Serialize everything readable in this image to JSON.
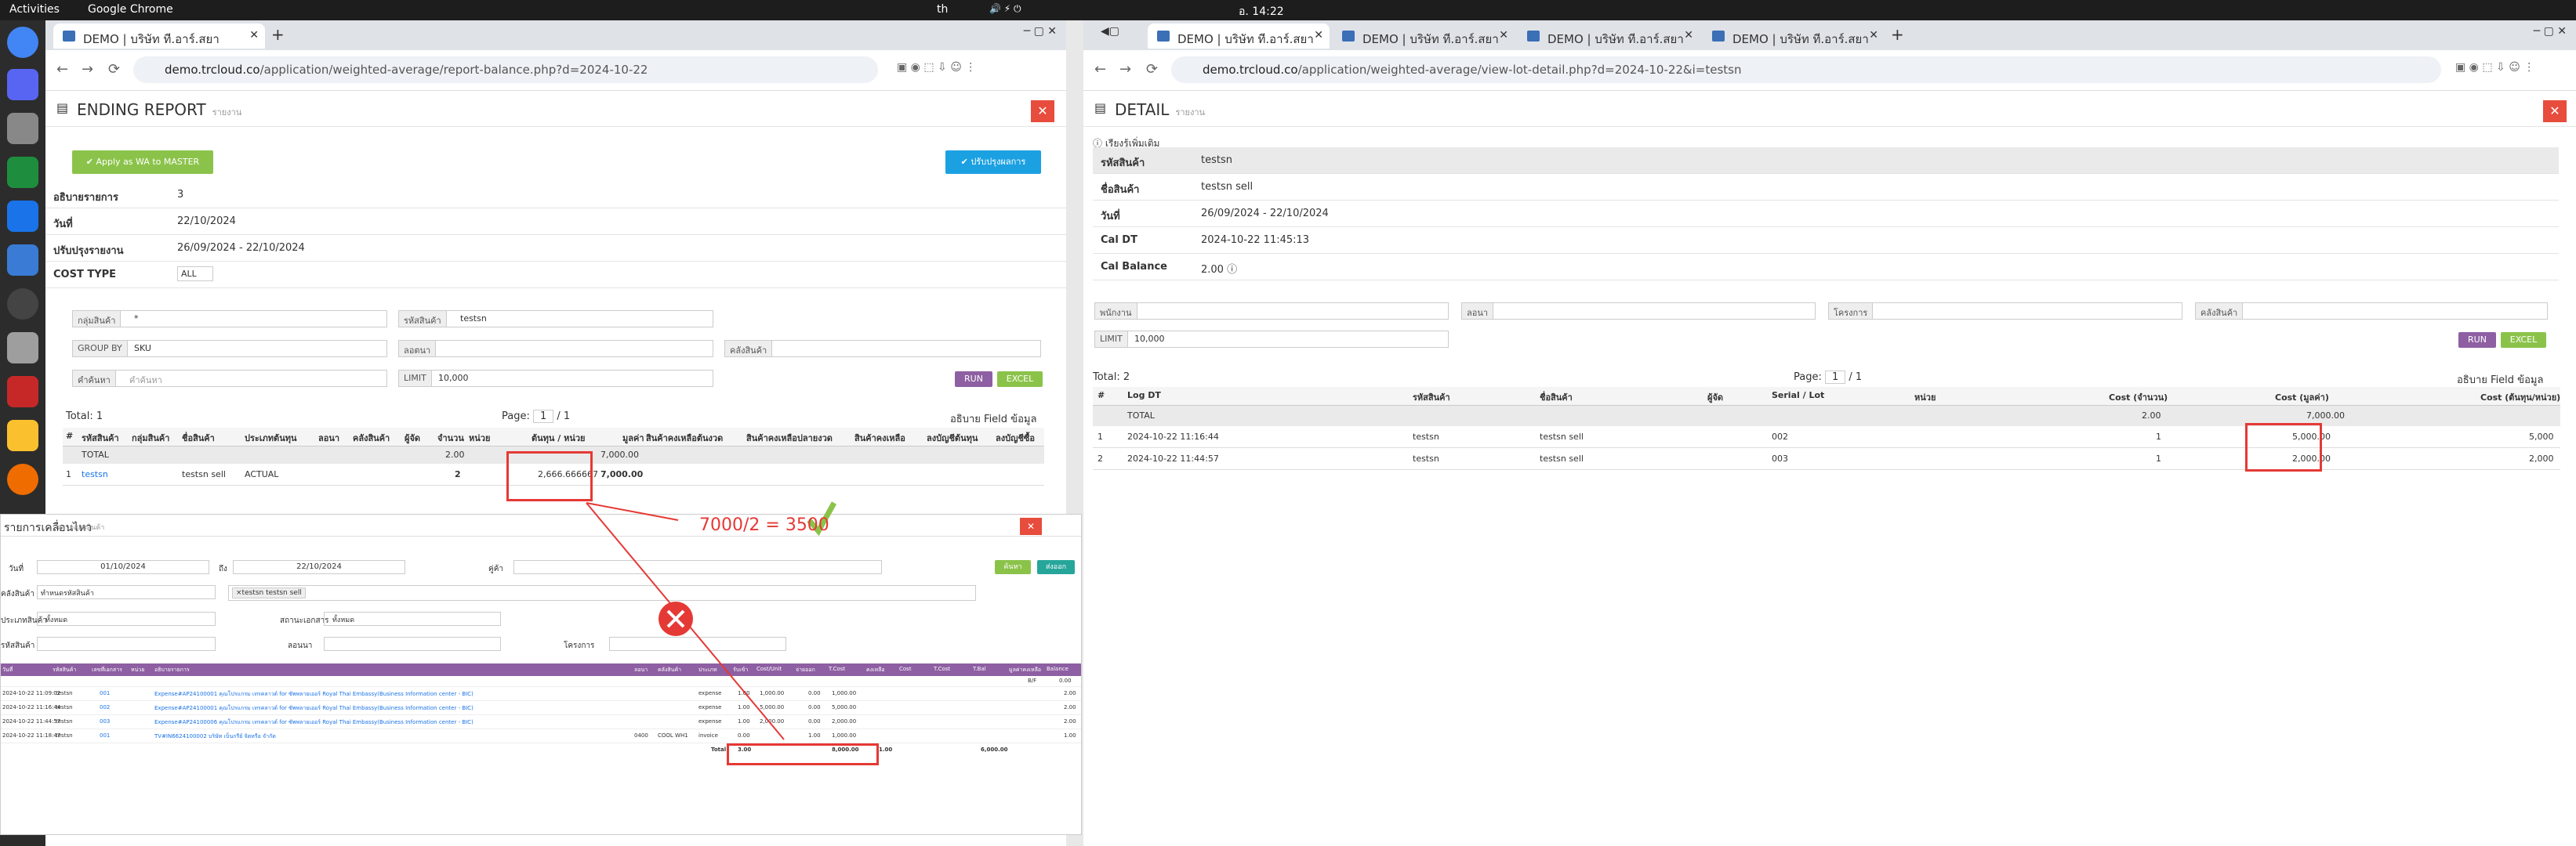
{
  "system": {
    "activities": "Activities",
    "app": "Google Chrome",
    "clock": "อ. 14:22",
    "lang": "th"
  },
  "left_window": {
    "tab_title": "DEMO | บริษัท ที.อาร์.สยา",
    "url_host": "demo.trcloud.co",
    "url_path": "/application/weighted-average/report-balance.php?d=2024-10-22",
    "page_title": "ENDING REPORT",
    "page_sub": "รายงาน",
    "apply_btn": "✔ Apply as WA to MASTER",
    "adjust_btn": "✔ ปรับปรุงผลการ",
    "fields": [
      {
        "k": "อธิบายรายการ",
        "v": "3"
      },
      {
        "k": "วันที่",
        "v": "22/10/2024"
      },
      {
        "k": "ปรับปรุงรายงาน",
        "v": "26/09/2024 - 22/10/2024"
      },
      {
        "k": "COST TYPE",
        "v": "ALL"
      }
    ],
    "filters": {
      "group": "กลุ่มสินค้า",
      "group_v": "*",
      "sku": "รหัสสินค้า",
      "sku_v": "testsn",
      "groupby": "GROUP BY",
      "groupby_v": "SKU",
      "lot": "ลอตนา",
      "location": "คลังสินค้า",
      "search": "คำค้นหา",
      "search_ph": "คำค้นหา",
      "limit": "LIMIT",
      "limit_v": "10,000",
      "run": "RUN",
      "excel": "EXCEL"
    },
    "total": "Total: 1",
    "page_label": "Page:",
    "page_v": "1",
    "page_of": "/ 1",
    "field_info": "อธิบาย Field ข้อมูล",
    "headers": [
      "#",
      "รหัสสินค้า",
      "กลุ่มสินค้า",
      "ชื่อสินค้า",
      "ประเภทต้นทุน",
      "ลอนา",
      "คลังสินค้า",
      "ผู้จัด",
      "จำนวน",
      "หน่วย",
      "ต้นทุน / หน่วย",
      "มูลค่า",
      "สินค้าคงเหลือต้นงวด",
      "สินค้าคงเหลือปลายงวด",
      "สินค้าคงเหลือ",
      "ลงบัญชีต้นทุน",
      "ลงบัญชีซื้อ"
    ],
    "total_row": {
      "label": "TOTAL",
      "qty": "2.00",
      "value": "7,000.00"
    },
    "data_row": {
      "n": "1",
      "sku": "testsn",
      "name": "testsn sell",
      "type": "ACTUAL",
      "qty": "2",
      "unit_cost": "2,666.666667",
      "value": "7,000.00"
    }
  },
  "annotation": {
    "formula": "7000/2 = 3500"
  },
  "modal": {
    "title": "รายการเคลื่อนไหว",
    "sub": "ตรวจสอบสินค้า",
    "date_label": "วันที่",
    "date_from": "01/10/2024",
    "to": "ถึง",
    "date_to": "22/10/2024",
    "partner": "คู่ค้า",
    "branch": "คลังสินค้า",
    "branch_v": "ทำหนดรหัสสินค้า",
    "item_tag": "×testsn testsn sell",
    "type": "ประเภทสินค้า",
    "type_v": "ทั้งหมด",
    "status": "สถานะเอกสาร",
    "status_v": "ทั้งหมด",
    "sku": "รหัสสินค้า",
    "lot": "ลอนนา",
    "project": "โครงการ",
    "search_btn": "ค้นหา",
    "export_btn": "ส่งออก",
    "headers": [
      "วันที่",
      "รหัสสินค้า",
      "เลขที่เอกสาร",
      "หน่วย",
      "อธิบายรายการ",
      "ลอนา",
      "คลังสินค้า",
      "ประเภท",
      "รับเข้า",
      "Cost/Unit",
      "จ่ายออก",
      "T.Cost",
      "คงเหลือ",
      "Cost",
      "T.Cost",
      "T.Bal",
      "มูลค่าคงเหลือ",
      "Balance"
    ],
    "bf": "B/F",
    "bf_v": "0.00",
    "rows": [
      {
        "d": "2024-10-22 11:09:02",
        "sku": "testsn",
        "doc": "001",
        "desc": "Expense#AP24100001 คุณโปรแกรม เทรคลาวด์ for ซัพพลายเออร์ Royal Thai Embassy(Business Information center - BIC)",
        "type": "expense",
        "in": "1.00",
        "cu": "1,000.00",
        "out": "0.00",
        "tc": "1,000.00",
        "bal": "2.00"
      },
      {
        "d": "2024-10-22 11:16:44",
        "sku": "testsn",
        "doc": "002",
        "desc": "Expense#AP24100001 คุณโปรแกรม เทรคลาวด์ for ซัพพลายเออร์ Royal Thai Embassy(Business Information center - BIC)",
        "type": "expense",
        "in": "1.00",
        "cu": "5,000.00",
        "out": "0.00",
        "tc": "5,000.00",
        "bal": "2.00"
      },
      {
        "d": "2024-10-22 11:44:57",
        "sku": "testsn",
        "doc": "003",
        "desc": "Expense#AP24100006 คุณโปรแกรม เทรคลาวด์ for ซัพพลายเออร์ Royal Thai Embassy(Business Information center - BIC)",
        "type": "expense",
        "in": "1.00",
        "cu": "2,000.00",
        "out": "0.00",
        "tc": "2,000.00",
        "bal": "2.00"
      },
      {
        "d": "2024-10-22 11:18:47",
        "sku": "testsn",
        "doc": "001",
        "desc": "TV#IN6624100002 บริษัท เบ็นกรีย์ จิตหรือ จำกัด",
        "lot": "0400",
        "loc": "COOL WH1",
        "type": "invoice",
        "in": "0.00",
        "cu": "",
        "out": "1.00",
        "tc": "1,000.00",
        "bal": "1.00"
      }
    ],
    "total_label": "Total",
    "total_in": "3.00",
    "total_tc": "8,000.00",
    "total_out": "1.00",
    "total_bal": "6,000.00"
  },
  "right_window": {
    "tabs": [
      "DEMO | บริษัท ที.อาร์.สยา",
      "DEMO | บริษัท ที.อาร์.สยา",
      "DEMO | บริษัท ที.อาร์.สยา",
      "DEMO | บริษัท ที.อาร์.สยา"
    ],
    "url_host": "demo.trcloud.co",
    "url_path": "/application/weighted-average/view-lot-detail.php?d=2024-10-22&i=testsn",
    "page_title": "DETAIL",
    "page_sub": "รายงาน",
    "section": "เรียงรู้เพิ่มเติม",
    "fields": [
      {
        "k": "รหัสสินค้า",
        "v": "testsn"
      },
      {
        "k": "ชื่อสินค้า",
        "v": "testsn sell"
      },
      {
        "k": "วันที่",
        "v": "26/09/2024 - 22/10/2024"
      },
      {
        "k": "Cal DT",
        "v": "2024-10-22 11:45:13"
      },
      {
        "k": "Cal Balance",
        "v": "2.00"
      }
    ],
    "filters": {
      "f1": "พนักงาน",
      "f2": "ลอนา",
      "f3": "โครงการ",
      "f4": "คลังสินค้า",
      "limit": "LIMIT",
      "limit_v": "10,000",
      "run": "RUN",
      "excel": "EXCEL"
    },
    "total": "Total: 2",
    "page_label": "Page:",
    "page_v": "1",
    "page_of": "/ 1",
    "field_info": "อธิบาย Field ข้อมูล",
    "headers": [
      "#",
      "Log DT",
      "รหัสสินค้า",
      "ชื่อสินค้า",
      "ผู้จัด",
      "Serial / Lot",
      "หน่วย",
      "Cost (จำนวน)",
      "Cost (มูลค่า)",
      "Cost (ต้นทุน/หน่วย)"
    ],
    "total_row": {
      "label": "TOTAL",
      "qty": "2.00",
      "value": "7,000.00"
    },
    "rows": [
      {
        "n": "1",
        "dt": "2024-10-22 11:16:44",
        "sku": "testsn",
        "name": "testsn sell",
        "lot": "002",
        "qty": "1",
        "value": "5,000.00",
        "unit": "5,000"
      },
      {
        "n": "2",
        "dt": "2024-10-22 11:44:57",
        "sku": "testsn",
        "name": "testsn sell",
        "lot": "003",
        "qty": "1",
        "value": "2,000.00",
        "unit": "2,000"
      }
    ]
  }
}
